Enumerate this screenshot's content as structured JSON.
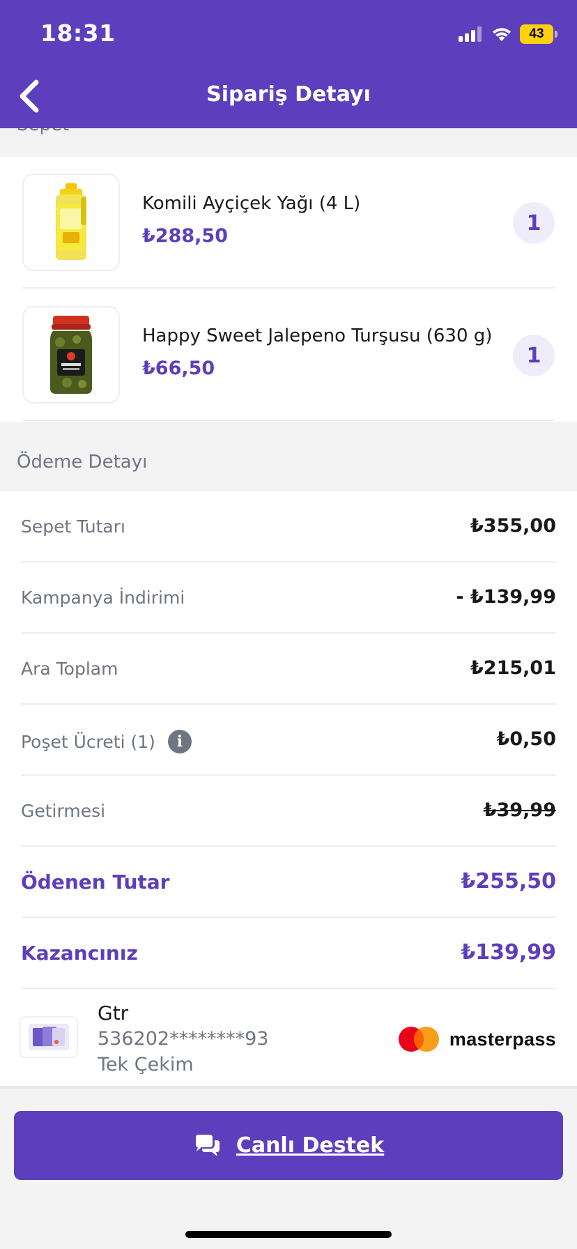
{
  "status_bar": {
    "time": "18:31",
    "battery": "43"
  },
  "header": {
    "title": "Sipariş Detayı"
  },
  "cart": {
    "section_label": "Sepet",
    "items": [
      {
        "name": "Komili Ayçiçek Yağı (4 L)",
        "price": "₺288,50",
        "quantity": "1",
        "image": "oil-bottle-icon"
      },
      {
        "name": "Happy Sweet Jalepeno Turşusu (630 g)",
        "price": "₺66,50",
        "quantity": "1",
        "image": "pickle-jar-icon"
      }
    ]
  },
  "payment": {
    "section_label": "Ödeme Detayı",
    "rows": [
      {
        "label": "Sepet Tutarı",
        "value": "₺355,00"
      },
      {
        "label": "Kampanya İndirimi",
        "value": "- ₺139,99"
      },
      {
        "label": "Ara Toplam",
        "value": "₺215,01"
      },
      {
        "label": "Poşet Ücreti (1)",
        "value": "₺0,50",
        "info": "i"
      },
      {
        "label": "Getirmesi",
        "value": "₺39,99",
        "strikethrough": true
      },
      {
        "label": "Ödenen Tutar",
        "value": "₺255,50",
        "highlight": true
      },
      {
        "label": "Kazancınız",
        "value": "₺139,99",
        "highlight": true
      }
    ],
    "card": {
      "name": "Gtr",
      "number": "536202********93",
      "type": "Tek Çekim",
      "provider": "masterpass"
    }
  },
  "support_button": {
    "label": "Canlı Destek",
    "icon": "chat-bubbles-icon"
  },
  "colors": {
    "brand": "#5d3ebc",
    "muted": "#6f7581",
    "background": "#f3f3f4",
    "battery": "#ffd10d"
  }
}
